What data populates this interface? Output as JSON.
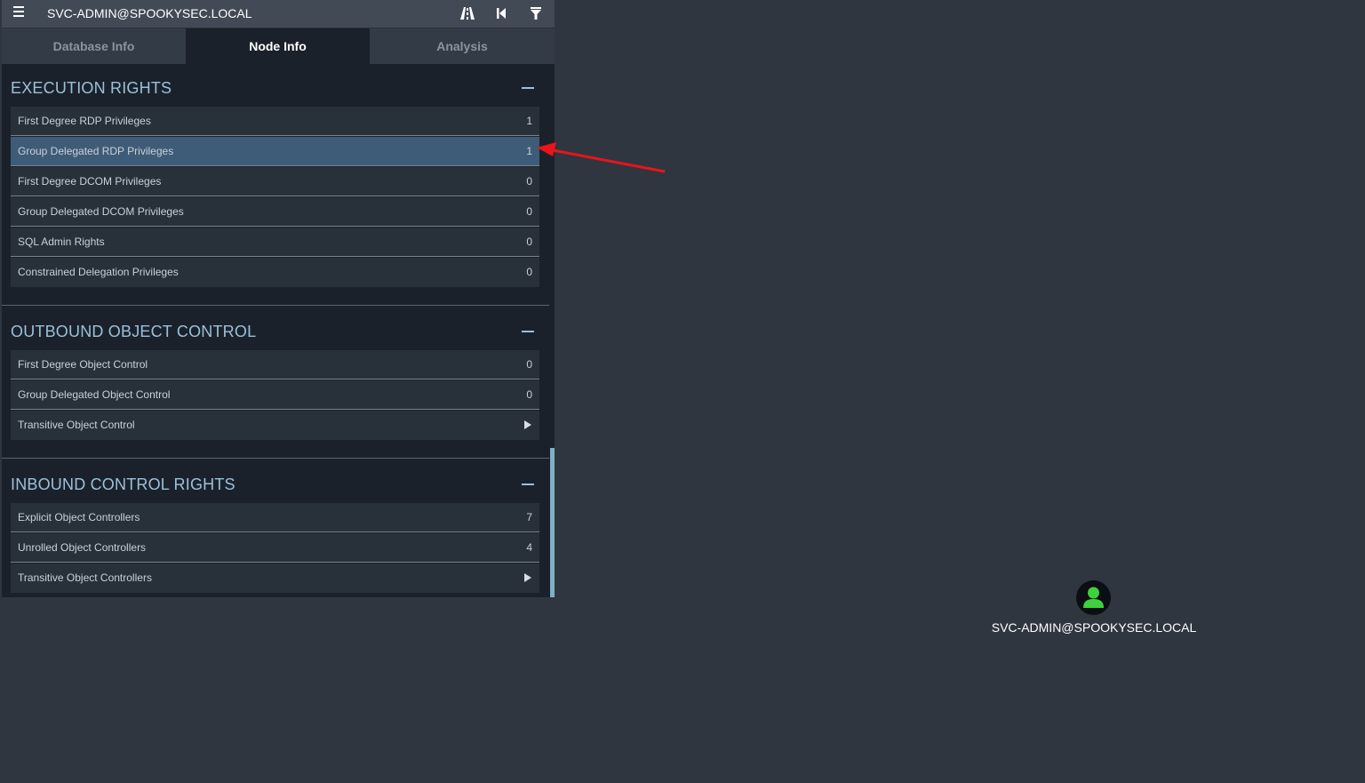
{
  "app": {
    "search_text": "SVC-ADMIN@SPOOKYSEC.LOCAL",
    "icons": [
      "menu-icon",
      "pathfinding-icon",
      "back-icon",
      "filter-icon"
    ]
  },
  "tabs": [
    {
      "label": "Database Info",
      "active": false
    },
    {
      "label": "Node Info",
      "active": true
    },
    {
      "label": "Analysis",
      "active": false
    }
  ],
  "sections": {
    "execution": {
      "title": "EXECUTION RIGHTS",
      "rows": [
        {
          "label": "First Degree RDP Privileges",
          "count": "1"
        },
        {
          "label": "Group Delegated RDP Privileges",
          "count": "1",
          "highlighted": true
        },
        {
          "label": "First Degree DCOM Privileges",
          "count": "0"
        },
        {
          "label": "Group Delegated DCOM Privileges",
          "count": "0"
        },
        {
          "label": "SQL Admin Rights",
          "count": "0"
        },
        {
          "label": "Constrained Delegation Privileges",
          "count": "0"
        }
      ]
    },
    "outbound": {
      "title": "OUTBOUND OBJECT CONTROL",
      "rows": [
        {
          "label": "First Degree Object Control",
          "count": "0"
        },
        {
          "label": "Group Delegated Object Control",
          "count": "0"
        },
        {
          "label": "Transitive Object Control",
          "count": ""
        }
      ]
    },
    "inbound": {
      "title": "INBOUND CONTROL RIGHTS",
      "rows": [
        {
          "label": "Explicit Object Controllers",
          "count": "7"
        },
        {
          "label": "Unrolled Object Controllers",
          "count": "4"
        },
        {
          "label": "Transitive Object Controllers",
          "count": ""
        }
      ]
    }
  },
  "graph": {
    "node_label": "SVC-ADMIN@SPOOKYSEC.LOCAL",
    "node_icon": "user-icon",
    "node_color": "#3ed13e"
  },
  "colors": {
    "accent": "#9bc1d9",
    "highlight_row": "#3e5c77",
    "annotation_arrow": "#e8151b"
  }
}
